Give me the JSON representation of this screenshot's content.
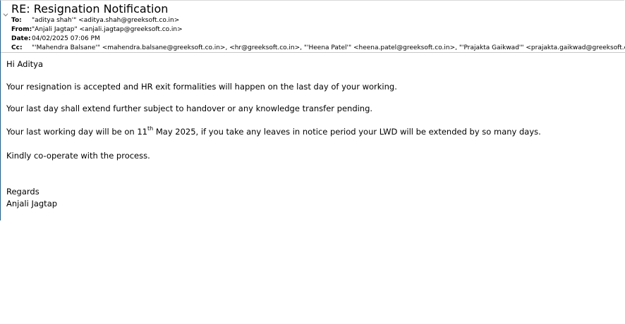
{
  "email": {
    "subject": "RE: Resignation Notification",
    "to_label": "To:",
    "to_value": "\"aditya shah'\" <aditya.shah@greeksoft.co.in>",
    "from_label": "From:",
    "from_value": "\"Anjali Jagtap\" <anjali.jagtap@greeksoft.co.in>",
    "date_label": "Date:",
    "date_value": "04/02/2025 07:06 PM",
    "cc_label": "Cc:",
    "cc_value": "\"'Mahendra Balsane'\" <mahendra.balsane@greeksoft.co.in>, <hr@greeksoft.co.in>, \"'Heena Patel'\" <heena.patel@greeksoft.co.in>, \"'Prajakta Gaikwad'\" <prajakta.gaikwad@greeksoft.co.in>"
  },
  "body": {
    "greeting": "Hi Aditya",
    "para1": "Your resignation is accepted and HR exit formalities will happen on the last day of your working.",
    "para2": "Your last day shall extend further subject to handover or any knowledge transfer pending.",
    "para3_before": "Your last working day will be on 11",
    "para3_sup": "th",
    "para3_after": " May 2025, if you take any leaves in notice period your LWD will be extended by so many days.",
    "para4": "Kindly co-operate with the process.",
    "regards": "Regards",
    "signature": "Anjali Jagtap"
  },
  "icons": {
    "collapse": "chevron-down-icon"
  }
}
